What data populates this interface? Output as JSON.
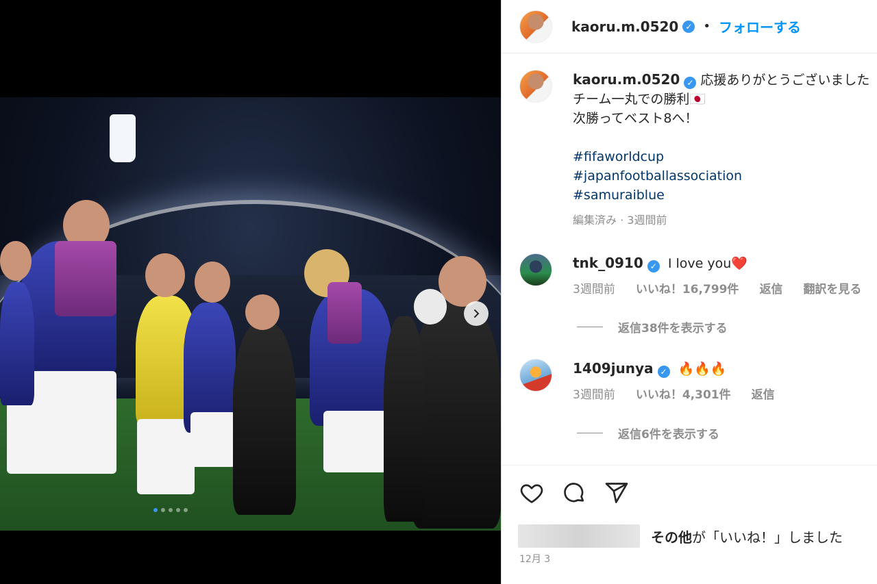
{
  "post": {
    "username": "kaoru.m.0520",
    "follow_separator": "•",
    "follow_label": "フォローする",
    "verified_glyph": "✓",
    "caption_line1": "応援ありがとうございました",
    "caption_line2": "チーム一丸での勝利🇯🇵",
    "caption_line3": "次勝ってベスト8へ！",
    "hashtags": [
      "#fifaworldcup",
      "#japanfootballassociation",
      "#samuraiblue"
    ],
    "caption_meta": "編集済み · 3週間前"
  },
  "comments": [
    {
      "username": "tnk_0910",
      "text": "I love you❤️",
      "time": "3週間前",
      "likes": "いいね！16,799件",
      "reply": "返信",
      "translate": "翻訳を見る",
      "view_replies": "返信38件を表示する"
    },
    {
      "username": "1409junya",
      "text": "🔥🔥🔥",
      "time": "3週間前",
      "likes": "いいね！4,301件",
      "reply": "返信",
      "view_replies": "返信6件を表示する"
    }
  ],
  "likes_summary": {
    "others_label": "その他",
    "suffix": "が「いいね！」しました"
  },
  "post_date": "12月 3",
  "carousel": {
    "current": 1,
    "total": 5
  },
  "colors": {
    "accent": "#0095f6",
    "verified": "#3897f0",
    "hashtag": "#00376b",
    "muted": "#8e8e8e"
  },
  "icons": [
    "heart-icon",
    "comment-icon",
    "share-icon",
    "chevron-right-icon",
    "verified-badge-icon"
  ]
}
